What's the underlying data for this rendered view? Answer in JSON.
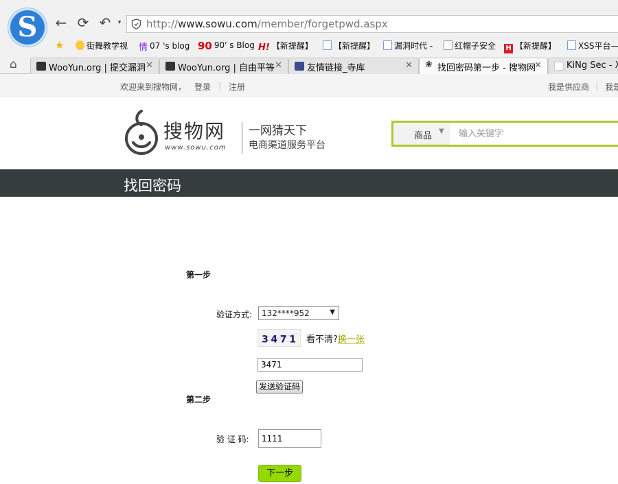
{
  "browser": {
    "url_prefix": "http://",
    "url_domain": "www.sowu.com",
    "url_path": "/member/forgetpwd.aspx",
    "bookmarks": [
      {
        "label": "街舞教学视"
      },
      {
        "label": "07 's blog"
      },
      {
        "label": "90' s Blog"
      },
      {
        "label": "【新提醒】"
      },
      {
        "label": "【新提醒】"
      },
      {
        "label": "漏洞时代 -"
      },
      {
        "label": "红帽子安全"
      },
      {
        "label": "【新提醒】"
      },
      {
        "label": "XSS平台—"
      }
    ],
    "tabs": [
      {
        "label": "WooYun.org | 提交漏洞"
      },
      {
        "label": "WooYun.org | 自由平等"
      },
      {
        "label": "友情链接_寺库"
      },
      {
        "label": "找回密码第一步 - 搜物网"
      },
      {
        "label": "KiNg Sec - X"
      }
    ]
  },
  "topbar": {
    "welcome": "欢迎来到搜物网，",
    "login": "登录",
    "register": "注册",
    "supplier": "我是供应商",
    "more": "我是"
  },
  "brand": {
    "name": "搜物网",
    "domain": "www.sowu.com",
    "slogan": "一网猜天下",
    "subtitle": "电商渠道服务平台"
  },
  "search": {
    "category": "商品",
    "placeholder": "输入关键字"
  },
  "page": {
    "title": "找回密码"
  },
  "form": {
    "step1_title": "第一步",
    "method_label": "验证方式:",
    "method_value": "132****952",
    "captcha_text": "3471",
    "captcha_unclear": "看不清?",
    "captcha_refresh": "换一张",
    "captcha_input_value": "3471",
    "send_code": "发送验证码",
    "step2_title": "第二步",
    "code_label": "验 证 码:",
    "code_value": "1111",
    "next": "下一步"
  },
  "colors": {
    "accent_green": "#95d800",
    "search_border": "#b2c72a",
    "title_bar": "#363d3e"
  }
}
